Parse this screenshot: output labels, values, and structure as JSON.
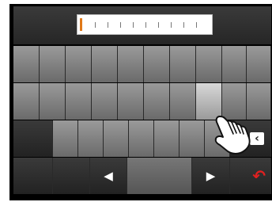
{
  "input": {
    "value": ""
  },
  "keys": {
    "prev_label": "◀",
    "next_label": "▶",
    "backspace_label": "‹",
    "undo_label": "↶"
  },
  "icons": {
    "backspace": "backspace-icon",
    "undo": "undo-icon",
    "hand": "pointing-hand-icon"
  },
  "colors": {
    "cursor": "#e07818",
    "undo": "#e02020"
  }
}
